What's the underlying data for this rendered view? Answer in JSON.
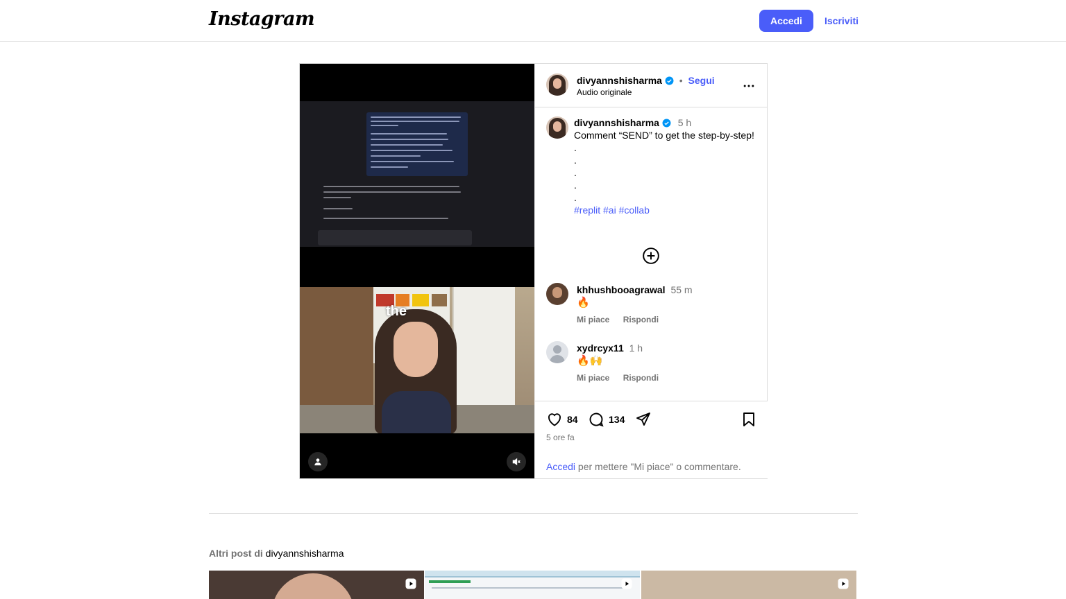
{
  "nav": {
    "logo": "Instagram",
    "login": "Accedi",
    "signup": "Iscriviti"
  },
  "post": {
    "author": "divyannshisharma",
    "follow": "Segui",
    "separator": "•",
    "audio": "Audio originale",
    "video_caption_word": "the",
    "caption": {
      "time": "5 h",
      "text": "Comment “SEND” to get the step-by-step!",
      "dots": [
        ".",
        ".",
        ".",
        ".",
        "."
      ],
      "tags": "#replit #ai #collab"
    },
    "comments": [
      {
        "user": "khhushbooagrawal",
        "time": "55 m",
        "text": "🔥",
        "like": "Mi piace",
        "reply": "Rispondi"
      },
      {
        "user": "xydrcyx11",
        "time": "1 h",
        "text": "🔥🙌",
        "like": "Mi piace",
        "reply": "Rispondi"
      }
    ],
    "likes": "84",
    "comment_count": "134",
    "posted": "5 ore fa",
    "login_link": "Accedi",
    "login_text": " per mettere \"Mi piace\" o commentare."
  },
  "more_posts": {
    "label": "Altri post di ",
    "user": "divyannshisharma"
  },
  "colors": {
    "accent": "#4a5df9",
    "verified": "#0095f6",
    "muted": "#737373",
    "border": "#dbdbdb"
  },
  "icons": [
    "verified-icon",
    "more-icon",
    "add-circle-icon",
    "heart-icon",
    "comment-icon",
    "share-icon",
    "bookmark-icon",
    "user-tag-icon",
    "mute-icon",
    "reel-icon"
  ]
}
